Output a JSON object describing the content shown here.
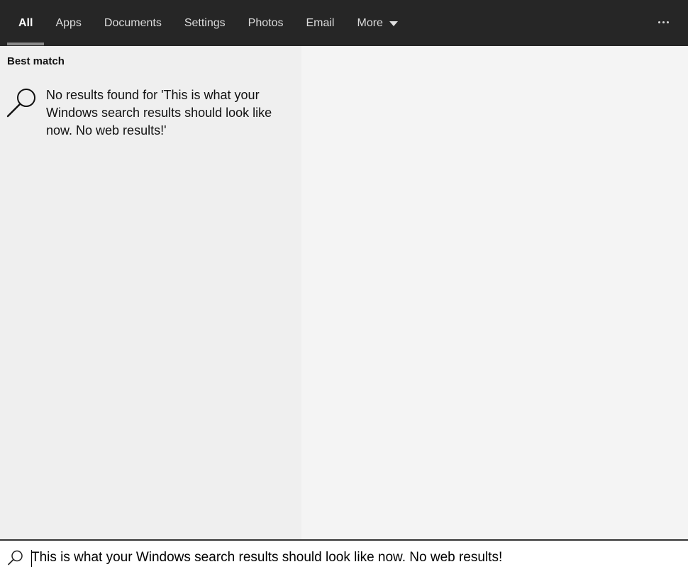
{
  "tabs": [
    {
      "label": "All",
      "active": true
    },
    {
      "label": "Apps"
    },
    {
      "label": "Documents"
    },
    {
      "label": "Settings"
    },
    {
      "label": "Photos"
    },
    {
      "label": "Email"
    },
    {
      "label": "More",
      "dropdown": true
    }
  ],
  "header": {
    "more_options_icon": "ellipsis-icon"
  },
  "results": {
    "section_title": "Best match",
    "best_match": {
      "icon": "search-icon",
      "text": "No results found for 'This is what your Windows search results should look like now. No web results!'"
    }
  },
  "search": {
    "icon": "search-icon",
    "value": "This is what your Windows search results should look like now. No web results!"
  },
  "colors": {
    "topbar": "#262626",
    "left_pane": "#efefef",
    "right_pane": "#f4f4f4",
    "active_tab_underline": "#8a8a8a"
  }
}
